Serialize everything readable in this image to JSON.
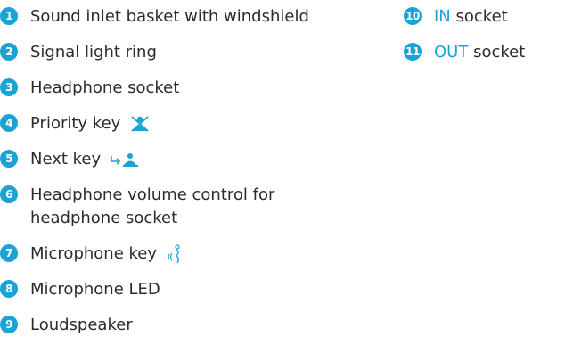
{
  "colors": {
    "badge": "#1aa3d6",
    "accent_text": "#1aa3d6",
    "body_text": "#2b2b2b"
  },
  "legend": {
    "left": [
      {
        "number": "1",
        "label": "Sound inlet basket with windshield"
      },
      {
        "number": "2",
        "label": "Signal light ring"
      },
      {
        "number": "3",
        "label": "Headphone socket"
      },
      {
        "number": "4",
        "label": "Priority key",
        "icon": "priority-speaker-icon"
      },
      {
        "number": "5",
        "label": "Next key",
        "icon": "next-speaker-icon"
      },
      {
        "number": "6",
        "label_line1": "Headphone volume control for",
        "label_line2": "headphone socket"
      },
      {
        "number": "7",
        "label": "Microphone key",
        "icon": "microphone-speech-icon"
      },
      {
        "number": "8",
        "label": "Microphone LED"
      },
      {
        "number": "9",
        "label": "Loudspeaker"
      }
    ],
    "right": [
      {
        "number": "10",
        "label_accent": "IN",
        "label_rest": " socket"
      },
      {
        "number": "11",
        "label_accent": "OUT",
        "label_rest": " socket"
      }
    ]
  }
}
